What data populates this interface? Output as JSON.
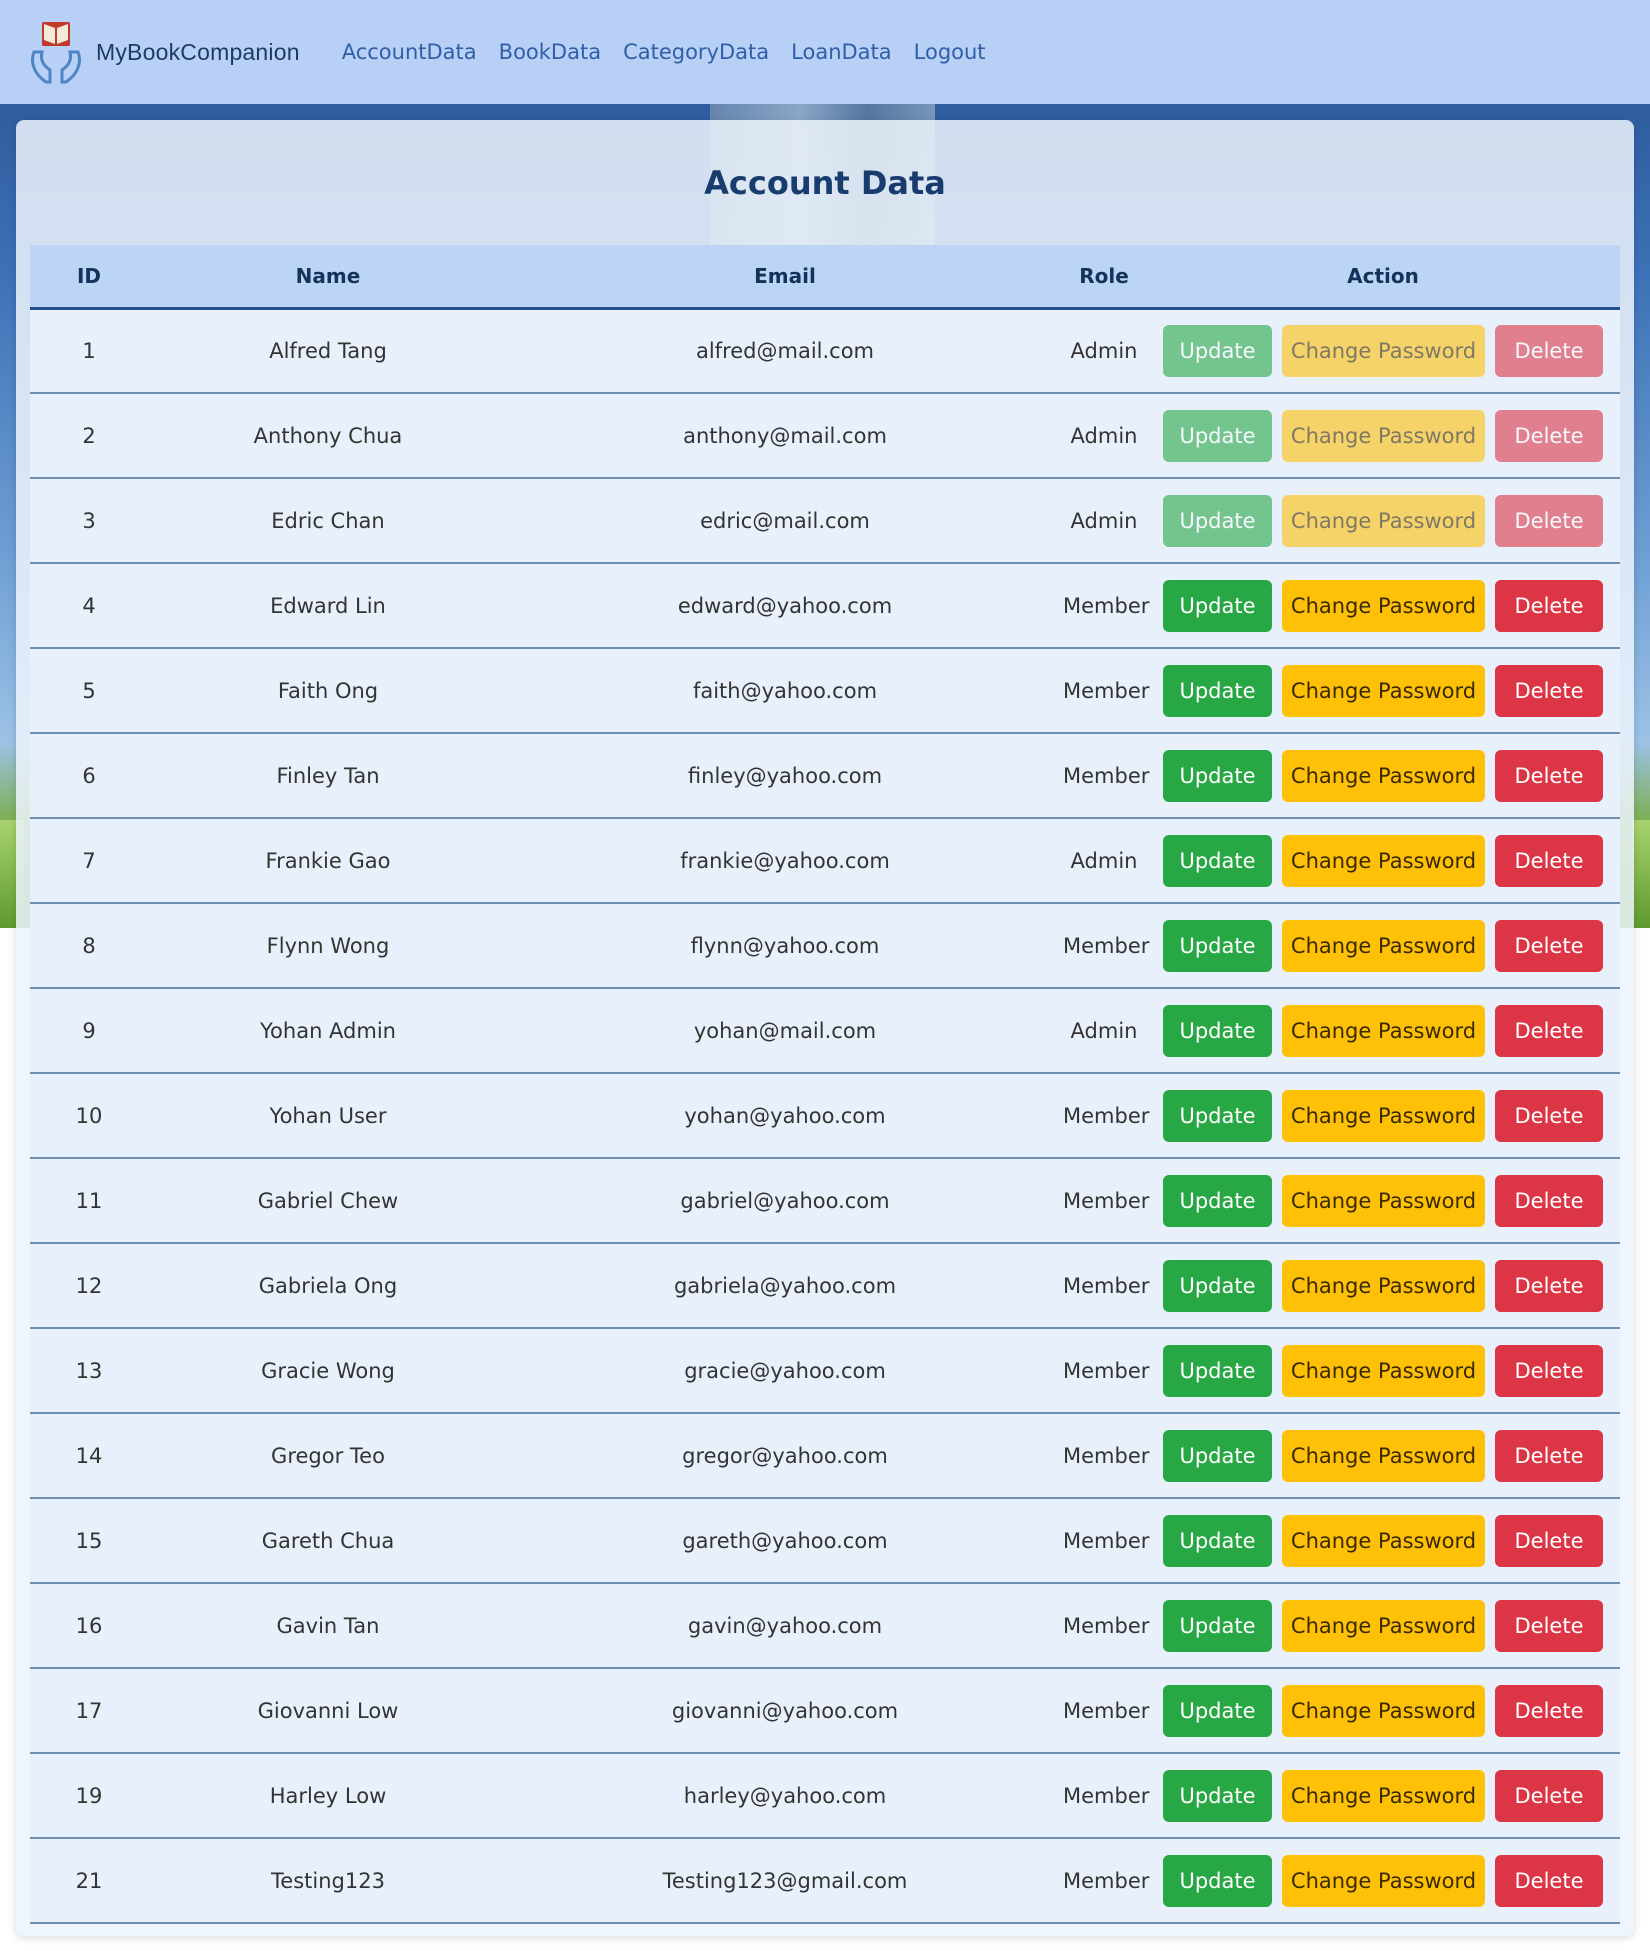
{
  "brand": {
    "name": "MyBookCompanion",
    "logo_icon": "book-hands-logo"
  },
  "nav": {
    "links": [
      "AccountData",
      "BookData",
      "CategoryData",
      "LoanData",
      "Logout"
    ]
  },
  "page": {
    "title": "Account Data"
  },
  "table": {
    "headers": [
      "ID",
      "Name",
      "Email",
      "Role",
      "Action"
    ],
    "rows": [
      {
        "id": "1",
        "name": "Alfred Tang",
        "email": "alfred@mail.com",
        "role": "Admin",
        "actions_disabled": true
      },
      {
        "id": "2",
        "name": "Anthony Chua",
        "email": "anthony@mail.com",
        "role": "Admin",
        "actions_disabled": true
      },
      {
        "id": "3",
        "name": "Edric Chan",
        "email": "edric@mail.com",
        "role": "Admin",
        "actions_disabled": true
      },
      {
        "id": "4",
        "name": "Edward Lin",
        "email": "edward@yahoo.com",
        "role": "Member",
        "actions_disabled": false
      },
      {
        "id": "5",
        "name": "Faith Ong",
        "email": "faith@yahoo.com",
        "role": "Member",
        "actions_disabled": false
      },
      {
        "id": "6",
        "name": "Finley Tan",
        "email": "finley@yahoo.com",
        "role": "Member",
        "actions_disabled": false
      },
      {
        "id": "7",
        "name": "Frankie Gao",
        "email": "frankie@yahoo.com",
        "role": "Admin",
        "actions_disabled": false
      },
      {
        "id": "8",
        "name": "Flynn Wong",
        "email": "flynn@yahoo.com",
        "role": "Member",
        "actions_disabled": false
      },
      {
        "id": "9",
        "name": "Yohan Admin",
        "email": "yohan@mail.com",
        "role": "Admin",
        "actions_disabled": false
      },
      {
        "id": "10",
        "name": "Yohan User",
        "email": "yohan@yahoo.com",
        "role": "Member",
        "actions_disabled": false
      },
      {
        "id": "11",
        "name": "Gabriel Chew",
        "email": "gabriel@yahoo.com",
        "role": "Member",
        "actions_disabled": false
      },
      {
        "id": "12",
        "name": "Gabriela Ong",
        "email": "gabriela@yahoo.com",
        "role": "Member",
        "actions_disabled": false
      },
      {
        "id": "13",
        "name": "Gracie Wong",
        "email": "gracie@yahoo.com",
        "role": "Member",
        "actions_disabled": false
      },
      {
        "id": "14",
        "name": "Gregor Teo",
        "email": "gregor@yahoo.com",
        "role": "Member",
        "actions_disabled": false
      },
      {
        "id": "15",
        "name": "Gareth Chua",
        "email": "gareth@yahoo.com",
        "role": "Member",
        "actions_disabled": false
      },
      {
        "id": "16",
        "name": "Gavin Tan",
        "email": "gavin@yahoo.com",
        "role": "Member",
        "actions_disabled": false
      },
      {
        "id": "17",
        "name": "Giovanni Low",
        "email": "giovanni@yahoo.com",
        "role": "Member",
        "actions_disabled": false
      },
      {
        "id": "19",
        "name": "Harley Low",
        "email": "harley@yahoo.com",
        "role": "Member",
        "actions_disabled": false
      },
      {
        "id": "21",
        "name": "Testing123",
        "email": "Testing123@gmail.com",
        "role": "Member",
        "actions_disabled": false
      }
    ]
  },
  "actions": {
    "update_label": "Update",
    "change_password_label": "Change Password",
    "delete_label": "Delete"
  },
  "colors": {
    "navbar_bg": "#b8d0f5",
    "nav_link": "#2f5fa8",
    "title": "#183c6e",
    "update": "#28a745",
    "change_password": "#ffc107",
    "delete": "#dc3545"
  }
}
